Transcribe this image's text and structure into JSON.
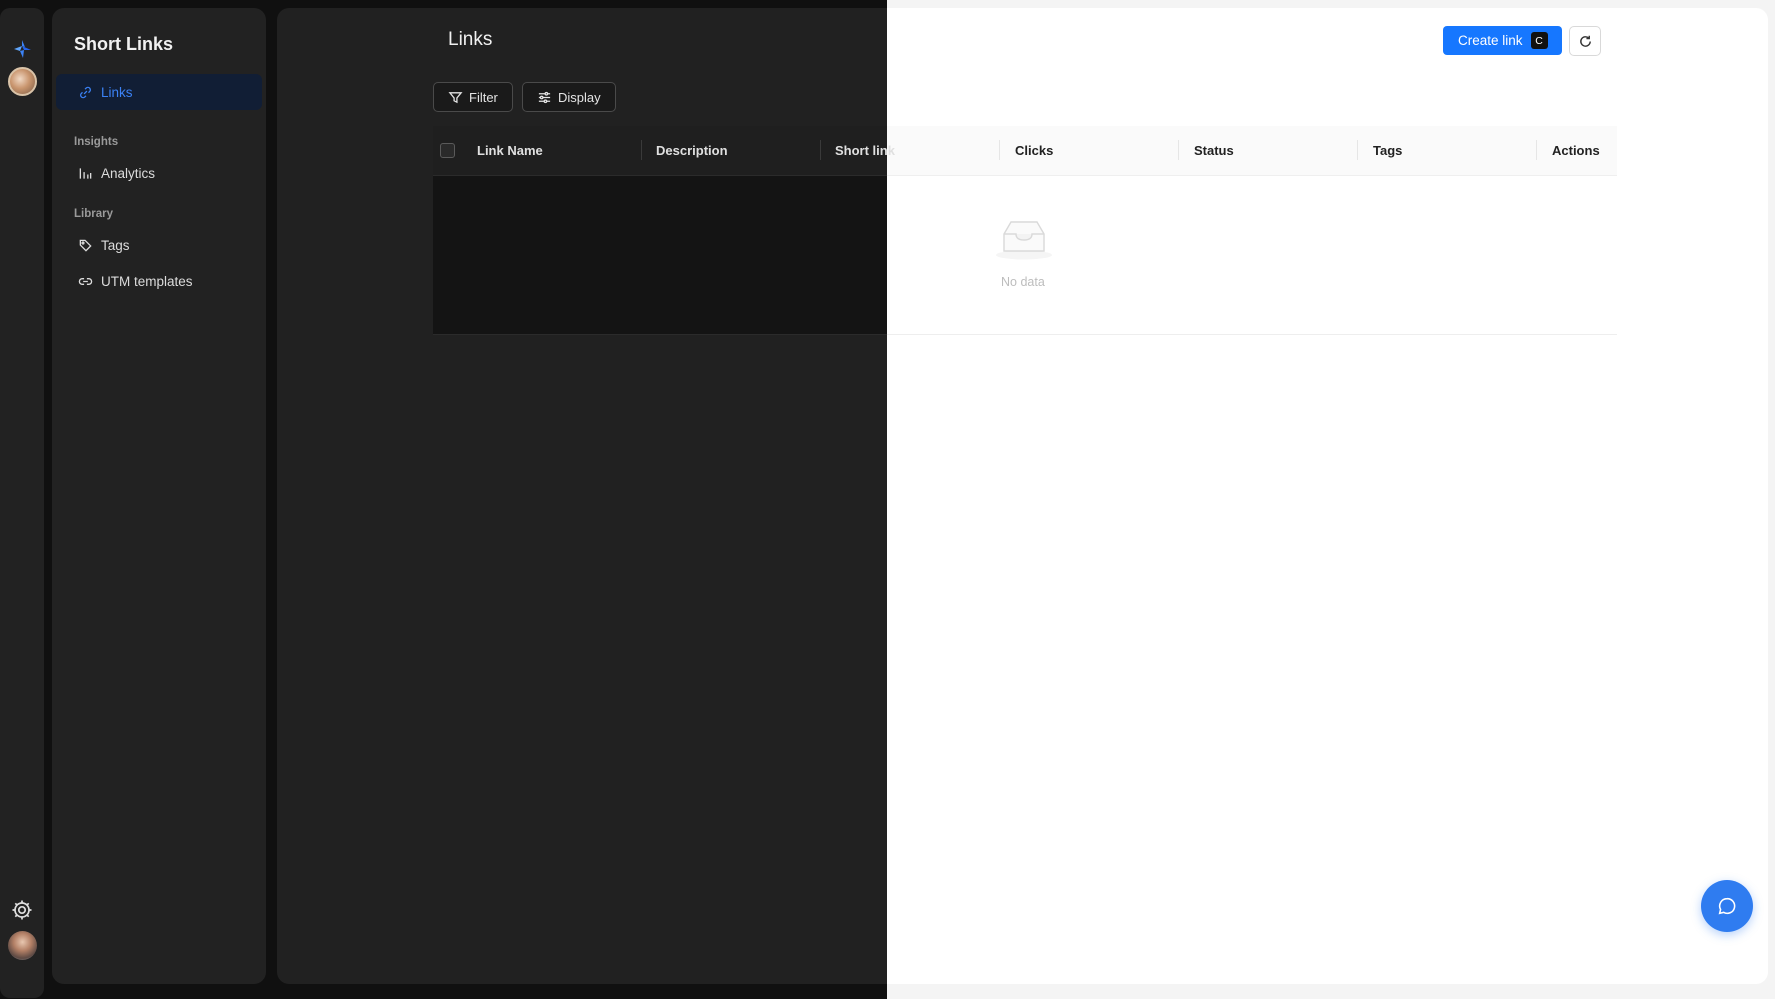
{
  "app": {
    "title": "Short Links"
  },
  "sidebar": {
    "items": [
      {
        "label": "Links",
        "icon": "link-icon",
        "active": true
      },
      {
        "label": "Analytics",
        "icon": "chart-bars-icon"
      },
      {
        "label": "Tags",
        "icon": "tag-icon"
      },
      {
        "label": "UTM templates",
        "icon": "link-icon"
      }
    ],
    "sections": {
      "insights": "Insights",
      "library": "Library"
    }
  },
  "main": {
    "title": "Links",
    "filter_label": "Filter",
    "display_label": "Display",
    "create_label": "Create link",
    "create_shortcut": "C",
    "empty_text": "No data"
  },
  "table": {
    "columns": [
      "Link Name",
      "Description",
      "Short link",
      "Clicks",
      "Status",
      "Tags",
      "Actions"
    ]
  },
  "colors": {
    "accent": "#1677ff",
    "dark_bg": "#212121",
    "active_nav_bg": "#111e35"
  }
}
